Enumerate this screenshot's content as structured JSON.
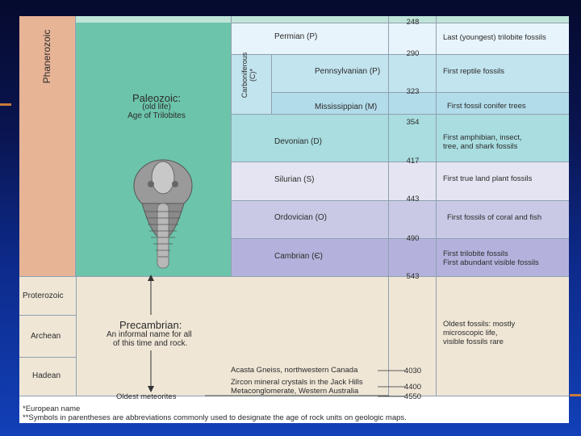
{
  "eons": {
    "phanerozoic": "Phanerozoic",
    "proterozoic": "Proterozoic",
    "archean": "Archean",
    "hadean": "Hadean"
  },
  "eras": {
    "paleozoic_title": "Paleozoic:",
    "paleozoic_sub1": "(old life)",
    "paleozoic_sub2": "Age of Trilobites",
    "precambrian_title": "Precambrian:",
    "precambrian_sub1": "An informal name for all",
    "precambrian_sub2": "of this time and rock."
  },
  "carboniferous": "Carboniferous (C)*",
  "periods": [
    {
      "name": "Permian (P)",
      "event": "Last (youngest) trilobite fossils"
    },
    {
      "name": "Pennsylvanian (P)",
      "event": "First reptile fossils"
    },
    {
      "name": "Mississippian (M)",
      "event": "First fossil conifer trees"
    },
    {
      "name": "Devonian (D)",
      "event": "First amphibian, insect, tree, and shark fossils"
    },
    {
      "name": "Silurian (S)",
      "event": "First true land plant fossils"
    },
    {
      "name": "Ordovician (O)",
      "event": "First fossils of coral and fish"
    },
    {
      "name": "Cambrian (Є)",
      "event": "First trilobite fossils First abundant visible fossils"
    }
  ],
  "cambrian_event_line1": "First trilobite fossils",
  "cambrian_event_line2": "First abundant visible fossils",
  "devonian_event_line1": "First amphibian, insect,",
  "devonian_event_line2": "tree, and shark fossils",
  "precambrian_event_line1": "Oldest fossils: mostly",
  "precambrian_event_line2": "microscopic life,",
  "precambrian_event_line3": "visible fossils rare",
  "ages": [
    "248",
    "290",
    "323",
    "354",
    "417",
    "443",
    "490",
    "543",
    "4030",
    "4400",
    "4550"
  ],
  "hadean_notes": {
    "acasta": "Acasta Gneiss, northwestern Canada",
    "zircon1": "Zircon mineral crystals in the Jack Hills",
    "zircon2": "Metaconglomerate, Western Australia",
    "meteorites": "Oldest meteorites"
  },
  "footnotes": {
    "f1": "*European name",
    "f2": "**Symbols in parentheses are abbreviations commonly used to designate the age of rock units on geologic maps."
  },
  "colors": {
    "phanerozoic": "#e8b496",
    "paleozoic": "#6cc4aa",
    "precambrian": "#efe6d6",
    "permian": "#e8f4fb",
    "carboniferous": "#c2e4ef",
    "devonian": "#a9dde0",
    "silurian": "#e4e4f2",
    "ordovician": "#c9c9e6",
    "cambrian": "#b4b2dc"
  },
  "icons": {
    "trilobite": "trilobite-icon"
  }
}
